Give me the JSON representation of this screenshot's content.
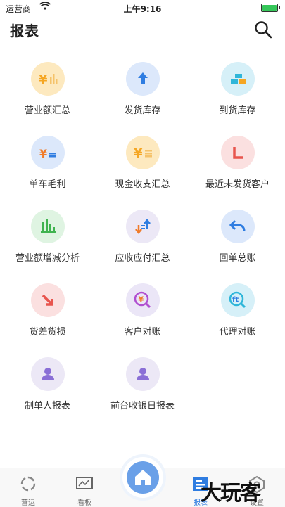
{
  "status_bar": {
    "carrier": "运营商",
    "time": "上午9:16"
  },
  "header": {
    "title": "报表"
  },
  "grid": {
    "items": [
      {
        "label": "营业额汇总"
      },
      {
        "label": "发货库存"
      },
      {
        "label": "到货库存"
      },
      {
        "label": "单车毛利"
      },
      {
        "label": "现金收支汇总"
      },
      {
        "label": "最近未发货客户"
      },
      {
        "label": "营业额增减分析"
      },
      {
        "label": "应收应付汇总"
      },
      {
        "label": "回单总账"
      },
      {
        "label": "货差货损"
      },
      {
        "label": "客户对账"
      },
      {
        "label": "代理对账"
      },
      {
        "label": "制单人报表"
      },
      {
        "label": "前台收银日报表"
      }
    ]
  },
  "tabbar": {
    "tabs": [
      {
        "label": "营运"
      },
      {
        "label": "看板"
      },
      {
        "label": "报表",
        "active": true
      },
      {
        "label": "设置"
      }
    ]
  },
  "watermark": "大玩客",
  "colors": {
    "accent": "#2f7de1",
    "yellow": "#f5a623",
    "orange": "#f07b2a"
  }
}
